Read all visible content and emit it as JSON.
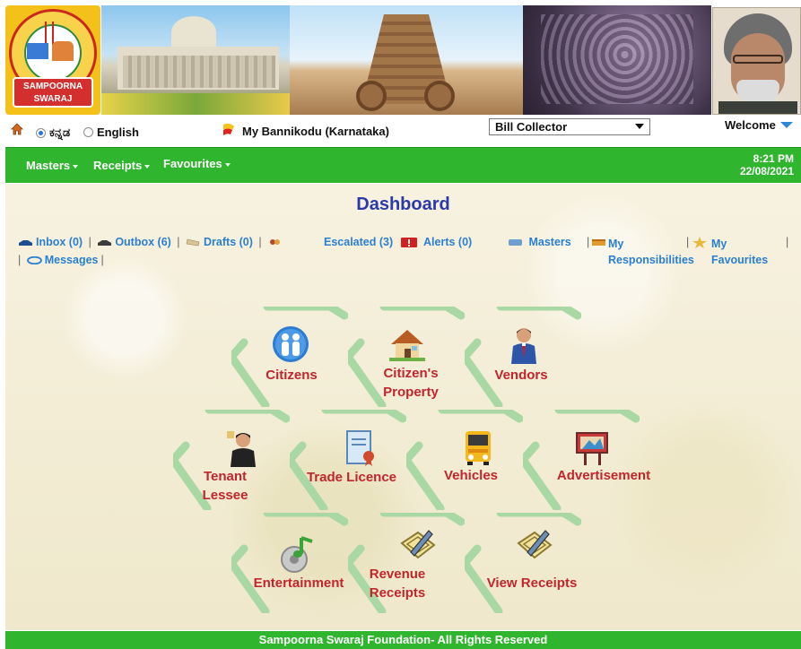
{
  "branding": {
    "logo_text_line1": "SAMPOORNA",
    "logo_text_line2": "SWARAJ"
  },
  "toolbar": {
    "language_kannada": "ಕನ್ನಡ",
    "language_english": "English",
    "selected_language": "ಕನ್ನಡ",
    "panchayat_name": "My Bannikodu (Karnataka)",
    "role_selected": "Bill Collector",
    "welcome_label": "Welcome"
  },
  "nav": {
    "items": [
      "Masters",
      "Receipts",
      "Favourites"
    ],
    "time": "8:21 PM",
    "date": "22/08/2021"
  },
  "main": {
    "title": "Dashboard",
    "quick_links": {
      "inbox": "Inbox (0)",
      "outbox": "Outbox (6)",
      "drafts": "Drafts (0)",
      "escalated": "Escalated (3)",
      "alerts": "Alerts (0)",
      "masters": "Masters",
      "my_responsibilities_1": "My",
      "my_responsibilities_2": "Responsibilities",
      "my_favourites_1": "My",
      "my_favourites_2": "Favourites",
      "messages": "Messages"
    },
    "tiles": [
      {
        "label1": "Citizens",
        "label2": "",
        "icon": "citizens-icon"
      },
      {
        "label1": "Citizen's",
        "label2": "Property",
        "icon": "house-icon"
      },
      {
        "label1": "Vendors",
        "label2": "",
        "icon": "vendor-icon"
      },
      {
        "label1": "Tenant",
        "label2": "Lessee",
        "icon": "tenant-icon"
      },
      {
        "label1": "Trade Licence",
        "label2": "",
        "icon": "certificate-icon"
      },
      {
        "label1": "Vehicles",
        "label2": "",
        "icon": "bus-icon"
      },
      {
        "label1": "Advertisement",
        "label2": "",
        "icon": "billboard-icon"
      },
      {
        "label1": "Entertainment",
        "label2": "",
        "icon": "music-icon"
      },
      {
        "label1": "Revenue",
        "label2": "Receipts",
        "icon": "receipt-pen-icon"
      },
      {
        "label1": "View Receipts",
        "label2": "",
        "icon": "receipt-pen-icon"
      }
    ]
  },
  "footer": {
    "text": "Sampoorna Swaraj Foundation- All Rights Reserved"
  },
  "colors": {
    "nav_green": "#2fb52e",
    "title_blue": "#2b3aa8",
    "link_blue": "#2a7fd0",
    "tile_label_red": "#c0262b",
    "hex_green": "#a9d8a4"
  }
}
